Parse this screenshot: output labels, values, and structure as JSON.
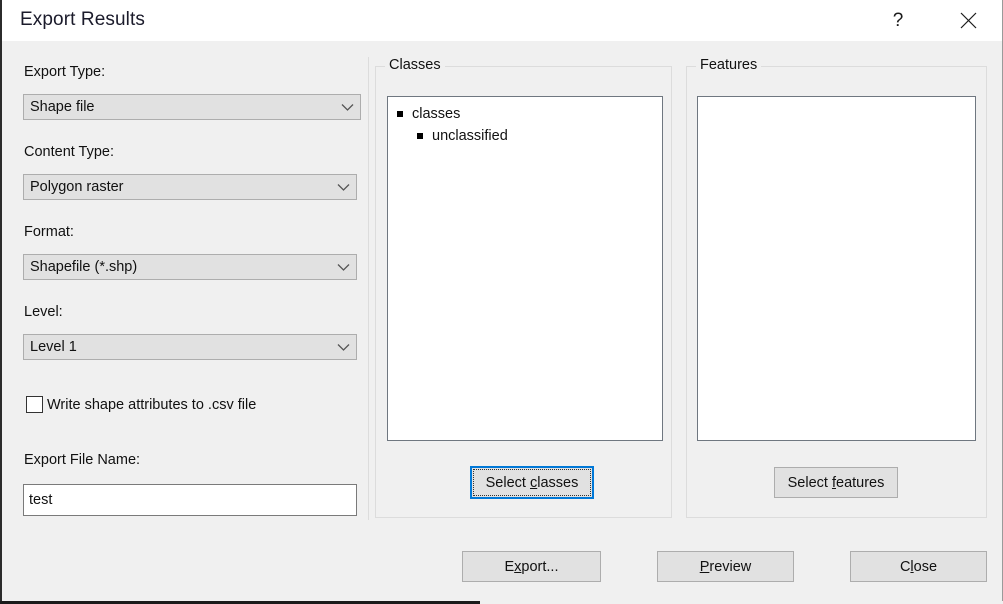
{
  "window": {
    "title": "Export Results",
    "help_icon": "question-mark-icon",
    "close_icon": "close-icon"
  },
  "left_panel": {
    "export_type": {
      "label": "Export Type:",
      "value": "Shape file"
    },
    "content_type": {
      "label": "Content Type:",
      "value": "Polygon raster"
    },
    "format": {
      "label": "Format:",
      "value": "Shapefile (*.shp)"
    },
    "level": {
      "label": "Level:",
      "value": "Level 1"
    },
    "write_csv": {
      "label": "Write shape attributes to .csv file",
      "checked": false
    },
    "export_file_name": {
      "label": "Export File Name:",
      "value": "test",
      "placeholder": ""
    }
  },
  "classes_group": {
    "title": "Classes",
    "tree": [
      {
        "label": "classes",
        "depth": 0
      },
      {
        "label": "unclassified",
        "depth": 1
      }
    ],
    "button": {
      "prefix": "Select ",
      "accel": "c",
      "suffix": "lasses",
      "focused": true
    }
  },
  "features_group": {
    "title": "Features",
    "items": [],
    "button": {
      "prefix": "Select ",
      "accel": "f",
      "suffix": "eatures",
      "focused": false
    }
  },
  "footer": {
    "export_button": {
      "prefix": "E",
      "accel": "x",
      "suffix": "port..."
    },
    "preview_button": {
      "prefix": "",
      "accel": "P",
      "suffix": "review"
    },
    "close_button": {
      "prefix": "C",
      "accel": "l",
      "suffix": "ose"
    }
  },
  "colors": {
    "accent_focus": "#0078d7",
    "dialog_bg": "#f0f0f0",
    "control_bg": "#e1e1e1",
    "field_bg": "#ffffff",
    "titlebar_bg": "#ffffff"
  }
}
